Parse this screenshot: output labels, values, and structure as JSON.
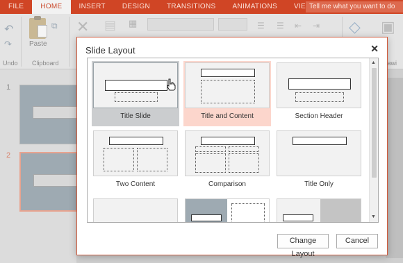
{
  "ribbon": {
    "tabs": [
      {
        "label": "FILE",
        "active": false
      },
      {
        "label": "HOME",
        "active": true
      },
      {
        "label": "INSERT",
        "active": false
      },
      {
        "label": "DESIGN",
        "active": false
      },
      {
        "label": "TRANSITIONS",
        "active": false
      },
      {
        "label": "ANIMATIONS",
        "active": false
      },
      {
        "label": "VIEW",
        "active": false
      }
    ],
    "tell_me_placeholder": "Tell me what you want to do",
    "paste_label": "Paste",
    "groups": {
      "undo": "Undo",
      "clipboard": "Clipboard",
      "drawing": "Drawi"
    },
    "accent_color": "#d04525"
  },
  "slides_panel": {
    "numbers": [
      "1",
      "2"
    ],
    "selected": "2"
  },
  "dialog": {
    "title": "Slide Layout",
    "close_icon": "close-icon",
    "layouts": [
      {
        "name": "Title Slide",
        "state": "hover"
      },
      {
        "name": "Title and Content",
        "state": "selected"
      },
      {
        "name": "Section Header",
        "state": "normal"
      },
      {
        "name": "Two Content",
        "state": "normal"
      },
      {
        "name": "Comparison",
        "state": "normal"
      },
      {
        "name": "Title Only",
        "state": "normal"
      }
    ],
    "buttons": {
      "change_layout": "Change Layout",
      "cancel": "Cancel"
    }
  }
}
